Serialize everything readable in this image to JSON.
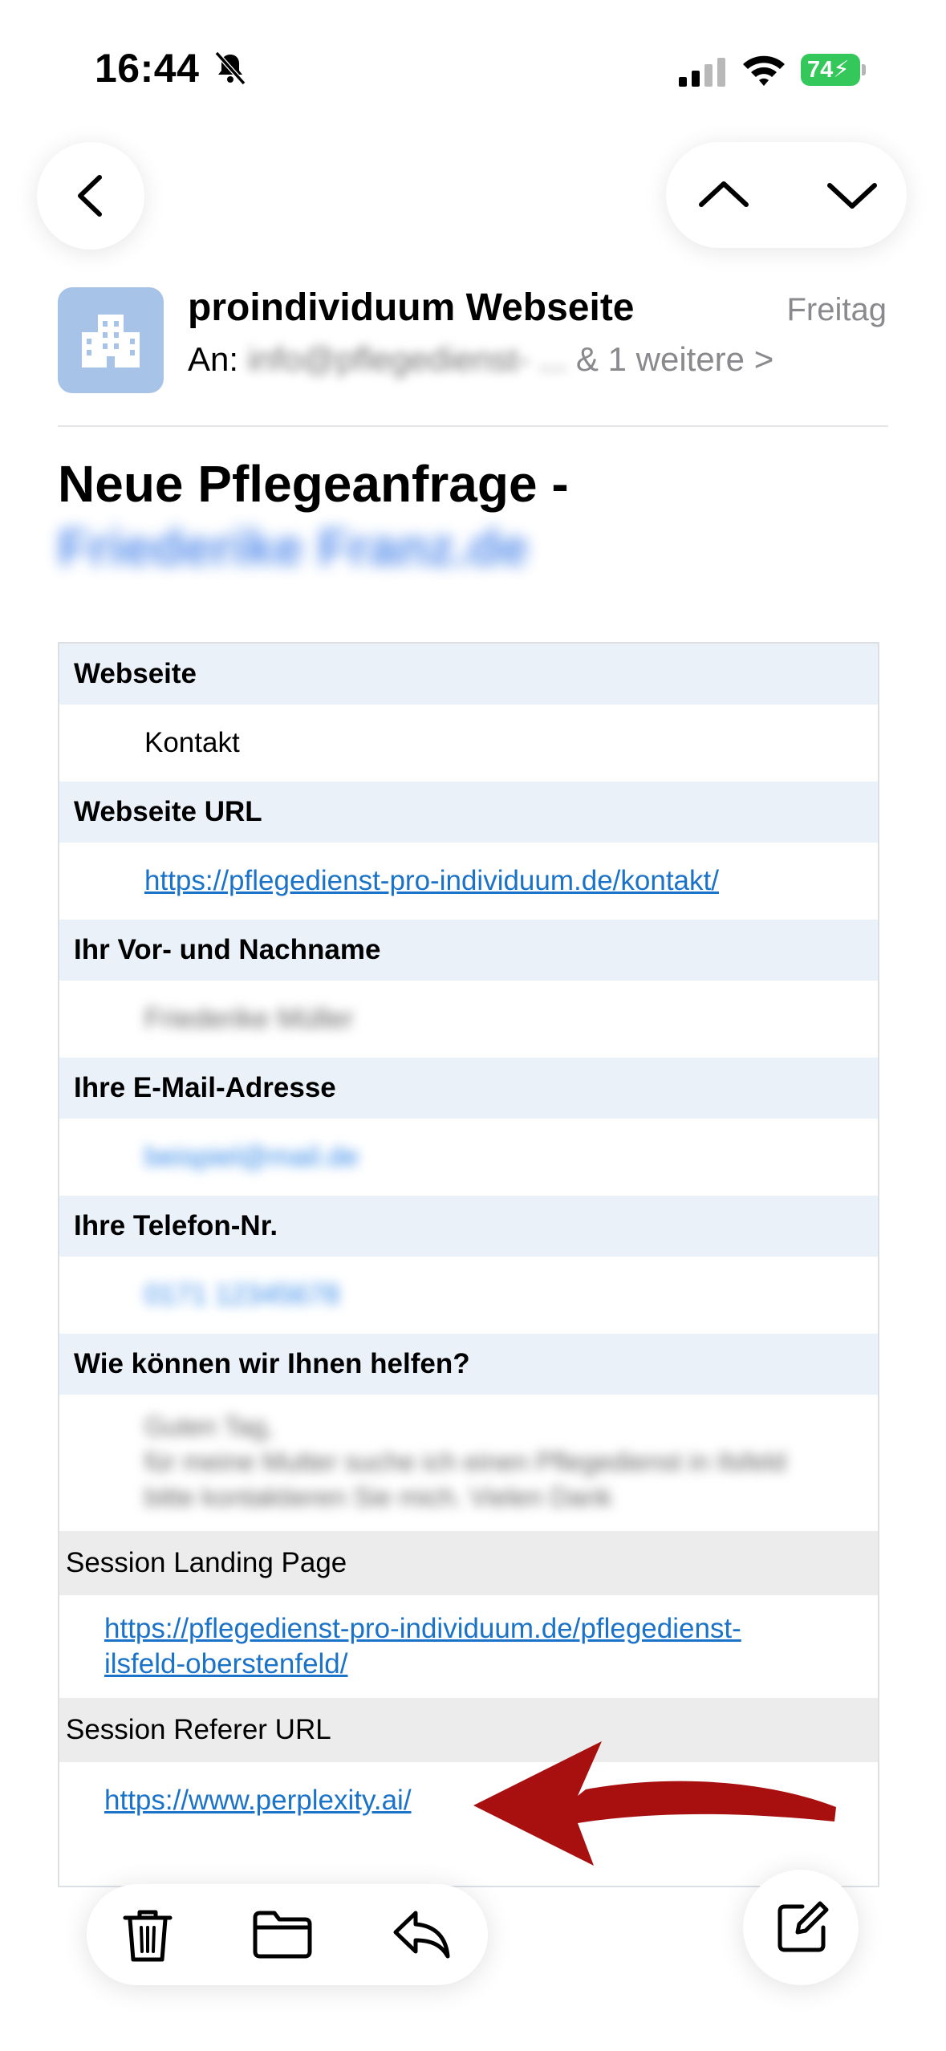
{
  "status_bar": {
    "time": "16:44",
    "battery": "74"
  },
  "header": {
    "sender": "proindividuum Webseite",
    "date": "Freitag",
    "to_label": "An:",
    "to_address": "info@pflegedienst- ...",
    "more_recipients": "& 1 weitere >"
  },
  "subject": {
    "line1": "Neue Pflegeanfrage -",
    "line2": "Friederike Franz.de"
  },
  "form": {
    "rows": [
      {
        "label": "Webseite",
        "value": "Kontakt"
      },
      {
        "label": "Webseite URL",
        "value": "https://pflegedienst-pro-individuum.de/kontakt/"
      },
      {
        "label": "Ihr Vor- und Nachname",
        "value": "Friederike Müller"
      },
      {
        "label": "Ihre E-Mail-Adresse",
        "value": "beispiel@mail.de"
      },
      {
        "label": "Ihre Telefon-Nr.",
        "value": "0171 12345678"
      },
      {
        "label": "Wie können wir Ihnen helfen?",
        "value_lines": [
          "Guten Tag,",
          "für meine Mutter suche ich einen Pflegedienst in Ilsfeld",
          "bitte kontaktieren Sie mich. Vielen Dank"
        ]
      }
    ],
    "session_landing_label": "Session Landing Page",
    "session_landing_url_1": "https://pflegedienst-pro-individuum.de/pflegedienst-",
    "session_landing_url_2": "ilsfeld-oberstenfeld/",
    "session_referer_label": "Session Referer URL",
    "session_referer_url": "https://www.perplexity.ai/"
  },
  "icons": {
    "back": "chevron-left-icon",
    "up": "chevron-up-icon",
    "down": "chevron-down-icon",
    "trash": "trash-icon",
    "folder": "folder-icon",
    "reply": "reply-icon",
    "compose": "compose-icon"
  },
  "colors": {
    "link": "#1a73c9",
    "label_row_bg": "#eaf1f9",
    "battery": "#34c759",
    "annotation_arrow": "#a80f0f"
  }
}
